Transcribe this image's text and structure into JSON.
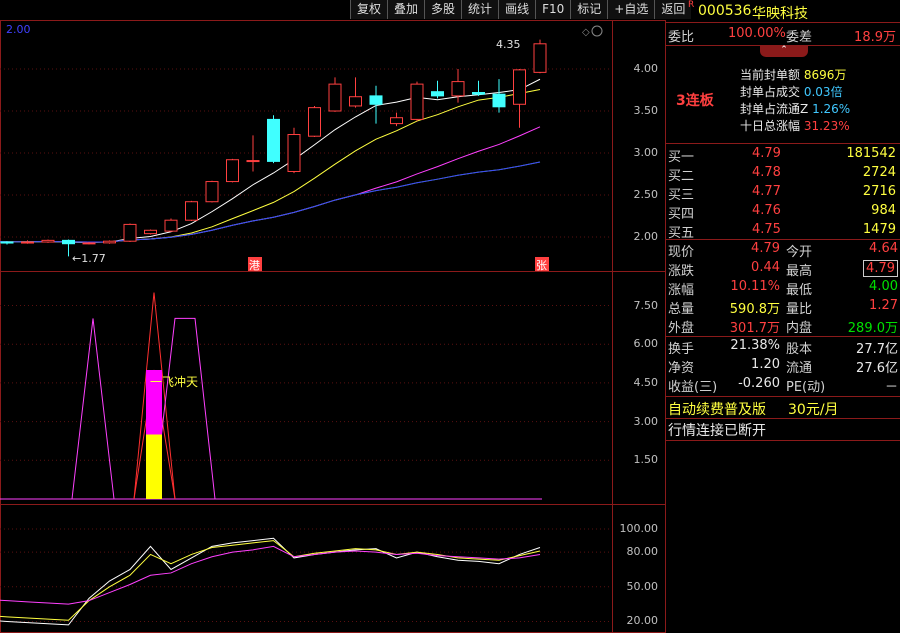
{
  "toolbar": [
    "复权",
    "叠加",
    "多股",
    "统计",
    "画线",
    "F10",
    "标记",
    "+自选",
    "返回"
  ],
  "main_chart": {
    "top_left_value": "2.00",
    "max_label": "4.35",
    "min_label": "1.77",
    "price_axis": [
      "4.00",
      "3.50",
      "3.00",
      "2.50",
      "2.00"
    ],
    "marker_gang": "港",
    "marker_zhang": "张",
    "candles": [
      {
        "o": 1.95,
        "c": 1.96,
        "h": 1.98,
        "l": 1.93
      },
      {
        "o": 1.96,
        "c": 1.94,
        "h": 1.97,
        "l": 1.92
      },
      {
        "o": 1.94,
        "c": 1.93,
        "h": 1.95,
        "l": 1.91
      },
      {
        "o": 1.93,
        "c": 1.94,
        "h": 1.96,
        "l": 1.92
      },
      {
        "o": 1.94,
        "c": 1.96,
        "h": 1.97,
        "l": 1.93
      },
      {
        "o": 1.96,
        "c": 1.92,
        "h": 1.97,
        "l": 1.77
      },
      {
        "o": 1.92,
        "c": 1.93,
        "h": 1.94,
        "l": 1.91
      },
      {
        "o": 1.93,
        "c": 1.95,
        "h": 1.96,
        "l": 1.92
      },
      {
        "o": 1.95,
        "c": 2.15,
        "h": 2.16,
        "l": 1.94
      },
      {
        "o": 2.04,
        "c": 2.08,
        "h": 2.09,
        "l": 2.03
      },
      {
        "o": 2.07,
        "c": 2.2,
        "h": 2.22,
        "l": 2.06
      },
      {
        "o": 2.2,
        "c": 2.42,
        "h": 2.43,
        "l": 2.19
      },
      {
        "o": 2.42,
        "c": 2.66,
        "h": 2.67,
        "l": 2.41
      },
      {
        "o": 2.66,
        "c": 2.92,
        "h": 2.93,
        "l": 2.65
      },
      {
        "o": 2.9,
        "c": 2.91,
        "h": 3.21,
        "l": 2.78
      },
      {
        "o": 3.4,
        "c": 2.9,
        "h": 3.45,
        "l": 2.88
      },
      {
        "o": 2.78,
        "c": 3.22,
        "h": 3.3,
        "l": 2.76
      },
      {
        "o": 3.2,
        "c": 3.54,
        "h": 3.56,
        "l": 3.19
      },
      {
        "o": 3.5,
        "c": 3.82,
        "h": 3.9,
        "l": 3.49
      },
      {
        "o": 3.56,
        "c": 3.67,
        "h": 3.9,
        "l": 3.54
      },
      {
        "o": 3.68,
        "c": 3.58,
        "h": 3.8,
        "l": 3.35
      },
      {
        "o": 3.35,
        "c": 3.42,
        "h": 3.48,
        "l": 3.32
      },
      {
        "o": 3.4,
        "c": 3.82,
        "h": 3.85,
        "l": 3.38
      },
      {
        "o": 3.73,
        "c": 3.68,
        "h": 3.86,
        "l": 3.65
      },
      {
        "o": 3.68,
        "c": 3.85,
        "h": 4.0,
        "l": 3.6
      },
      {
        "o": 3.72,
        "c": 3.7,
        "h": 3.86,
        "l": 3.68
      },
      {
        "o": 3.7,
        "c": 3.55,
        "h": 3.88,
        "l": 3.48
      },
      {
        "o": 3.58,
        "c": 3.99,
        "h": 4.0,
        "l": 3.3
      },
      {
        "o": 3.96,
        "c": 4.3,
        "h": 4.35,
        "l": 3.95
      }
    ]
  },
  "indicator1": {
    "axis": [
      "7.50",
      "6.00",
      "4.50",
      "3.00",
      "1.50"
    ],
    "label": "一飞冲天"
  },
  "indicator2": {
    "axis": [
      "100.00",
      "80.00",
      "50.00",
      "20.00"
    ]
  },
  "quote": {
    "code": "000536",
    "name": "华映科技",
    "r_mark": "R",
    "weibi_label": "委比",
    "weibi_value": "100.00%",
    "weicha_label": "委差",
    "weicha_value": "18.9万",
    "lianban": "3连板",
    "info": [
      {
        "label": "当前封单额",
        "value": "8696万"
      },
      {
        "label": "封单占成交",
        "value": "0.03倍"
      },
      {
        "label": "封单占流通Z",
        "value": "1.26%"
      },
      {
        "label": "十日总涨幅",
        "value": "31.23%"
      }
    ],
    "bids": [
      {
        "label": "买一",
        "price": "4.79",
        "vol": "181542"
      },
      {
        "label": "买二",
        "price": "4.78",
        "vol": "2724"
      },
      {
        "label": "买三",
        "price": "4.77",
        "vol": "2716"
      },
      {
        "label": "买四",
        "price": "4.76",
        "vol": "984"
      },
      {
        "label": "买五",
        "price": "4.75",
        "vol": "1479"
      }
    ],
    "stats": [
      {
        "l1": "现价",
        "v1": "4.79",
        "l2": "今开",
        "v2": "4.64"
      },
      {
        "l1": "涨跌",
        "v1": "0.44",
        "l2": "最高",
        "v2": "4.79"
      },
      {
        "l1": "涨幅",
        "v1": "10.11%",
        "l2": "最低",
        "v2": "4.00"
      },
      {
        "l1": "总量",
        "v1": "590.8万",
        "l2": "量比",
        "v2": "1.27"
      },
      {
        "l1": "外盘",
        "v1": "301.7万",
        "l2": "内盘",
        "v2": "289.0万"
      }
    ],
    "stats2": [
      {
        "l1": "换手",
        "v1": "21.38%",
        "l2": "股本",
        "v2": "27.7亿"
      },
      {
        "l1": "净资",
        "v1": "1.20",
        "l2": "流通",
        "v2": "27.6亿"
      },
      {
        "l1": "收益(三)",
        "v1": "-0.260",
        "l2": "PE(动)",
        "v2": "－"
      }
    ],
    "promo": "自动续费普及版",
    "price_tag": "30元/月",
    "status": "行情连接已断开"
  },
  "colors": {
    "up": "#ff4040",
    "down": "#40ffff",
    "ma5": "#ffffff",
    "ma10": "#ffff40",
    "ma20": "#ff40ff",
    "ma60": "#40ff40",
    "ma120": "#4040ff"
  }
}
